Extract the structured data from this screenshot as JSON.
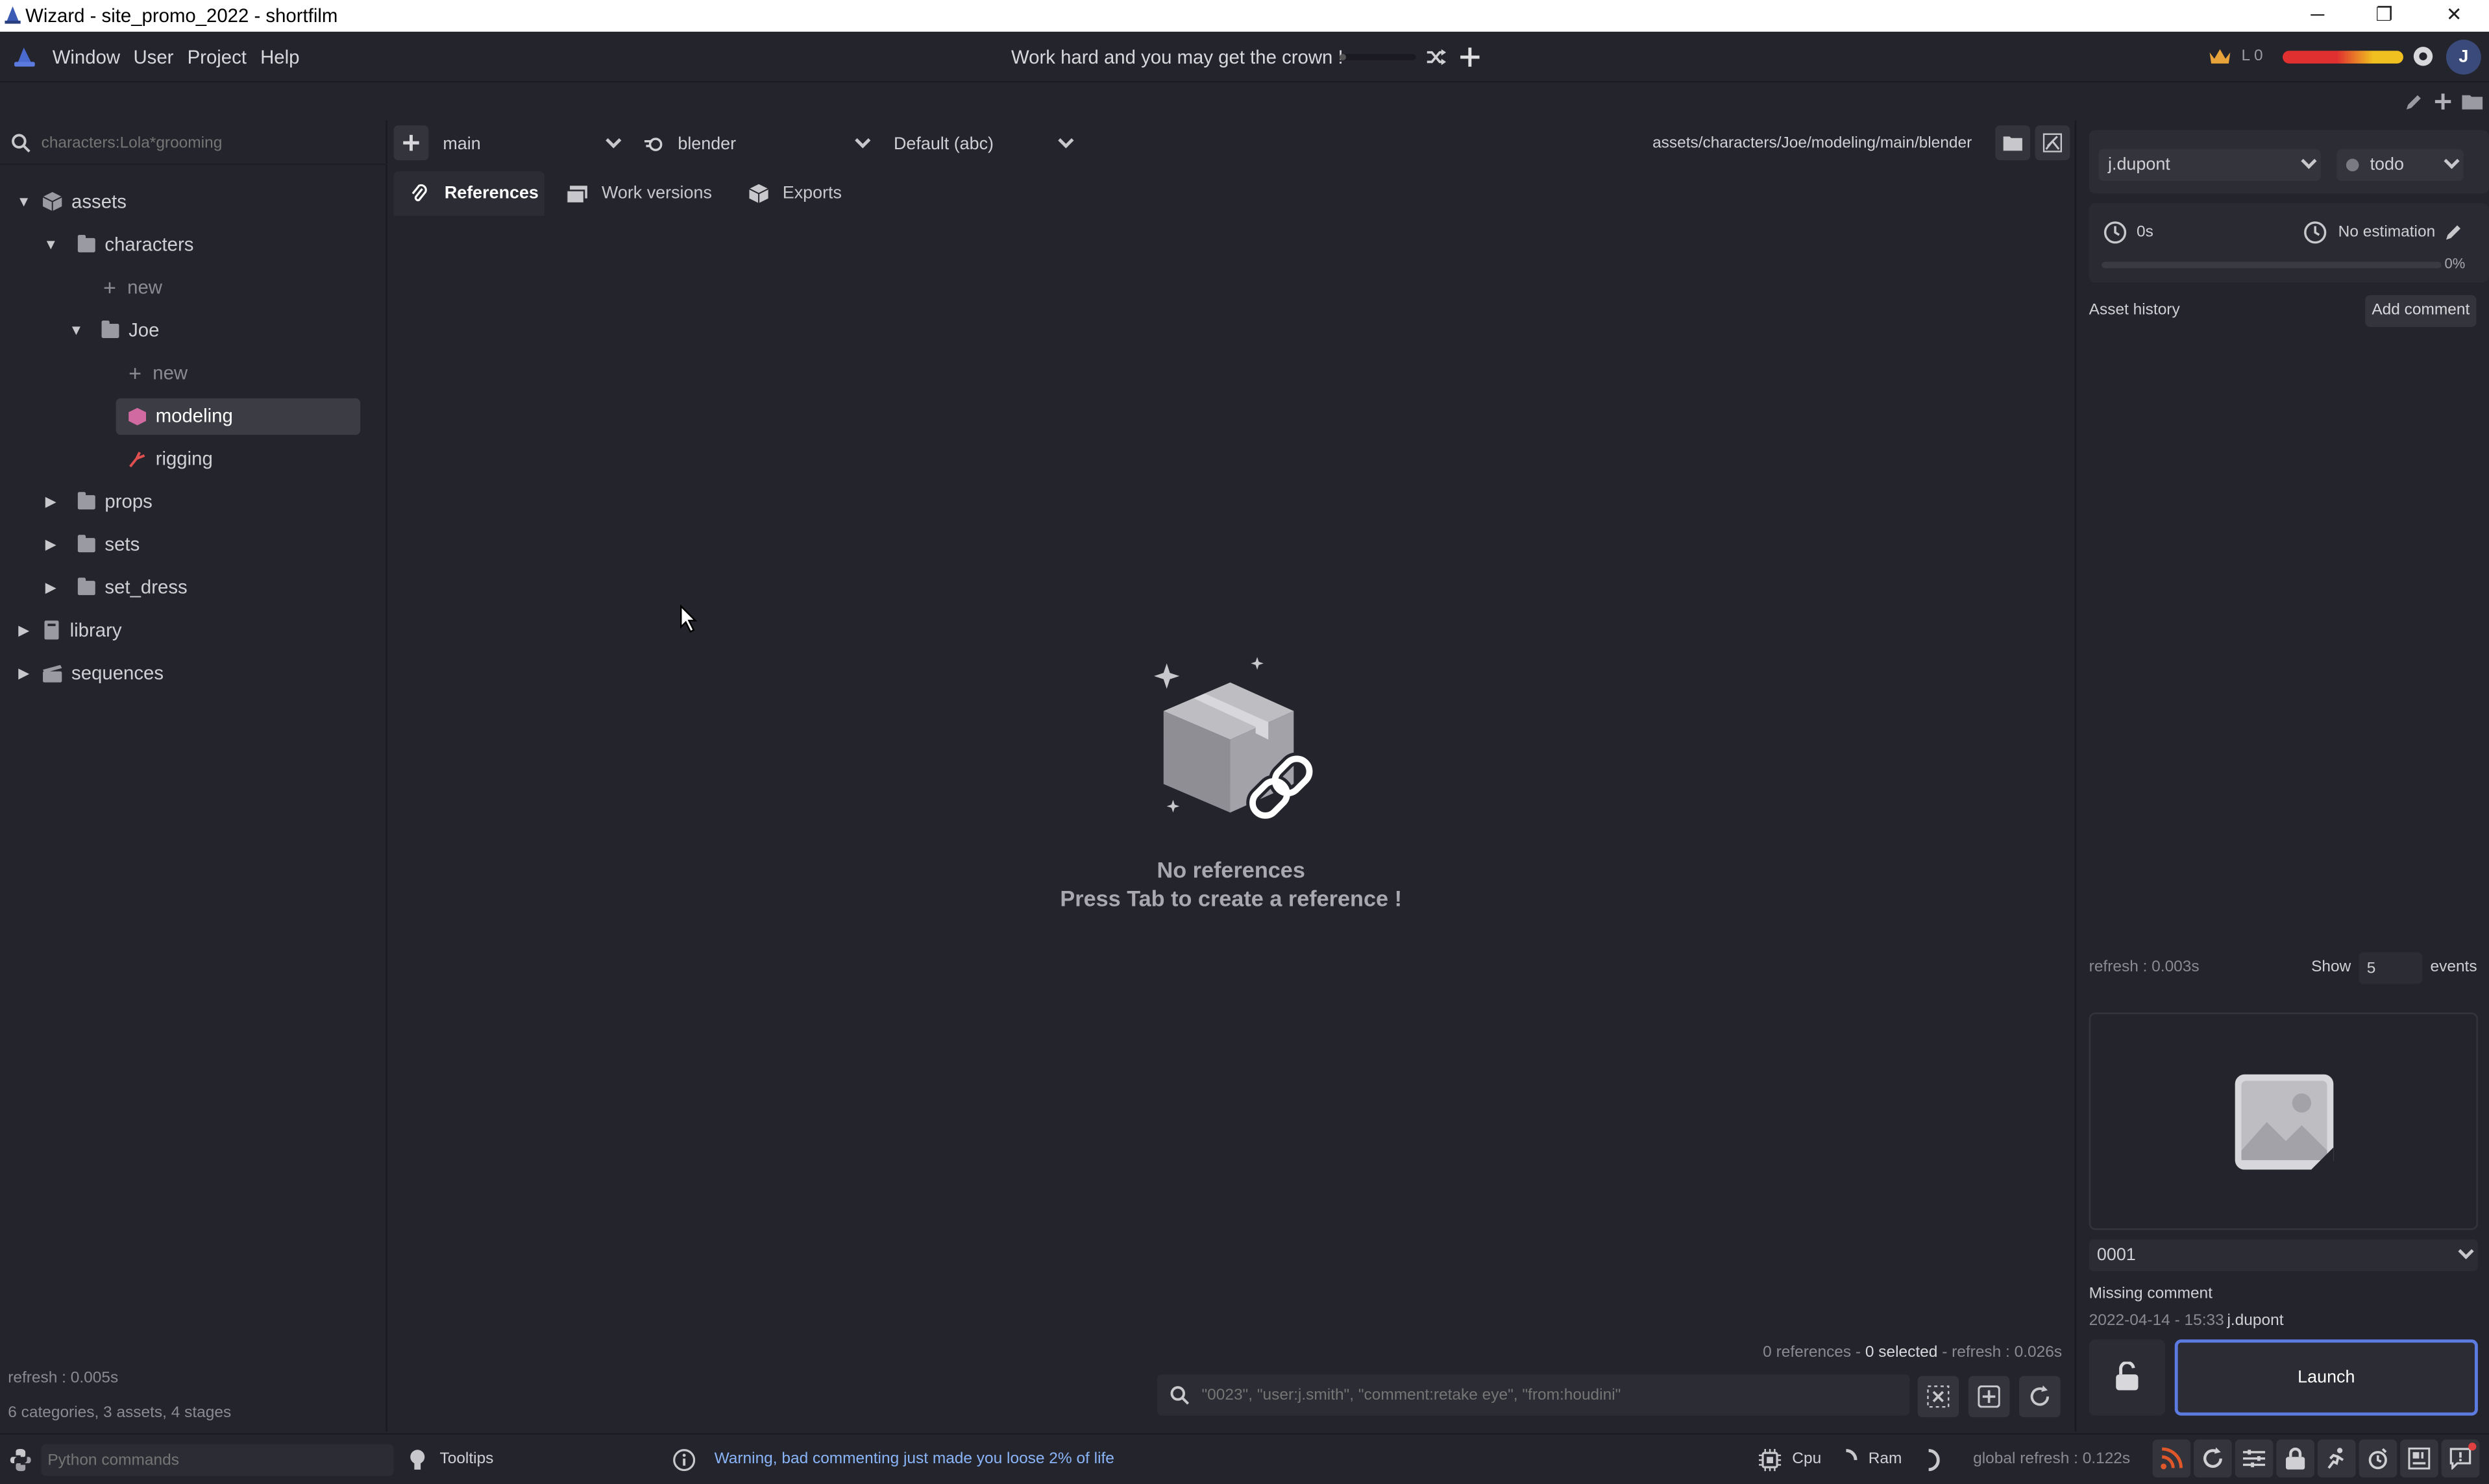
{
  "window": {
    "title": "Wizard - site_promo_2022 - shortfilm",
    "minimize": "─",
    "maximize": "❐",
    "close": "✕"
  },
  "menu": {
    "items": [
      "Window",
      "User",
      "Project",
      "Help"
    ],
    "motto": "Work hard and you may get the crown !",
    "level": "L 0",
    "avatar": "J"
  },
  "left": {
    "search_placeholder": "characters:Lola*grooming",
    "tree": {
      "assets": "assets",
      "characters": "characters",
      "new1": "new",
      "joe": "Joe",
      "new2": "new",
      "modeling": "modeling",
      "rigging": "rigging",
      "props": "props",
      "sets": "sets",
      "set_dress": "set_dress",
      "library": "library",
      "sequences": "sequences"
    },
    "refresh": "refresh : 0.005s",
    "summary": "6 categories, 3 assets, 4 stages"
  },
  "center": {
    "variant": "main",
    "software": "blender",
    "export_format": "Default (abc)",
    "path": "assets/characters/Joe/modeling/main/blender",
    "tabs": [
      "References",
      "Work versions",
      "Exports"
    ],
    "empty_title": "No references",
    "empty_hint": "Press Tab to create a reference !",
    "footer_refs": "0 references - ",
    "footer_selected": "0 selected",
    "footer_refresh": " - refresh : 0.026s",
    "search_placeholder": "\"0023\", \"user:j.smith\", \"comment:retake eye\", \"from:houdini\""
  },
  "right": {
    "user": "j.dupont",
    "state": "todo",
    "time_spent": "0s",
    "estimation": "No estimation",
    "progress_percent": "0%",
    "progress": 0,
    "history_label": "Asset history",
    "add_comment": "Add comment",
    "refresh": "refresh : 0.003s",
    "show_label": "Show",
    "show_count": "5",
    "events_label": "events",
    "version": "0001",
    "comment": "Missing comment",
    "date": "2022-04-14 - 15:33",
    "version_user": "j.dupont",
    "launch": "Launch"
  },
  "status": {
    "python_placeholder": "Python commands",
    "tooltips": "Tooltips",
    "warning": "Warning, bad commenting just made you loose 2% of life",
    "cpu": "Cpu",
    "ram": "Ram",
    "global_refresh": "global refresh : 0.122s"
  },
  "colors": {
    "bg": "#24242c",
    "accent_blue": "#7aa0ff",
    "warning_blue": "#8ab4f8",
    "modeling_pink": "#d06aa0",
    "rigging_red": "#e05050",
    "rss_orange": "#e0572a"
  }
}
